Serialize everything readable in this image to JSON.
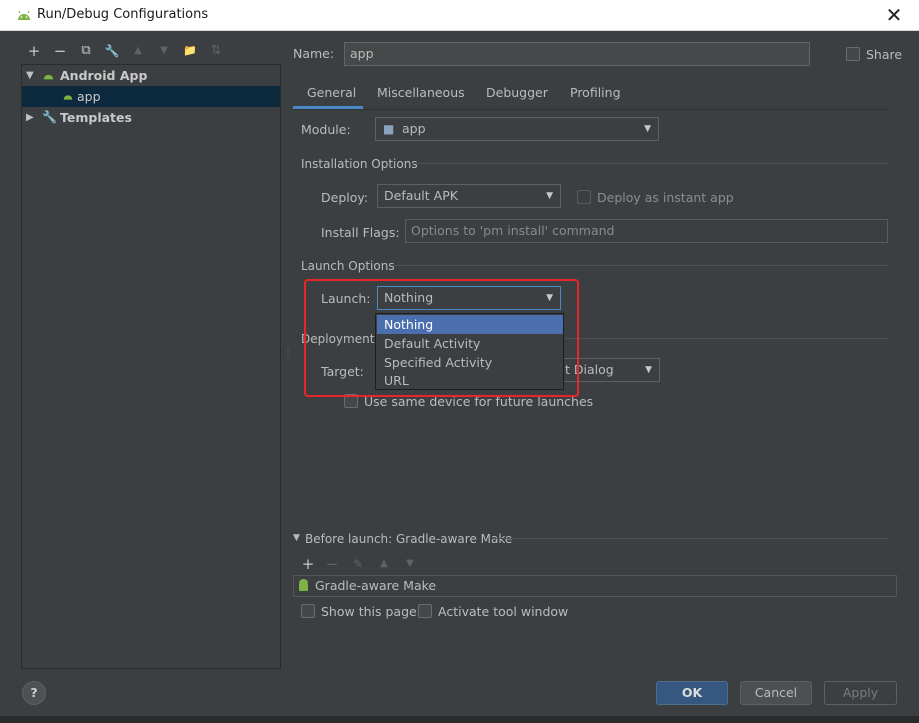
{
  "window": {
    "title": "Run/Debug Configurations",
    "close_glyph": "✕"
  },
  "left_toolbar": {
    "buttons": [
      {
        "name": "add",
        "glyph": "+"
      },
      {
        "name": "remove",
        "glyph": "−"
      },
      {
        "name": "copy",
        "glyph": "⧉"
      },
      {
        "name": "edit-defaults",
        "glyph": "🔧"
      },
      {
        "name": "move-up",
        "glyph": "▲"
      },
      {
        "name": "move-down",
        "glyph": "▼"
      },
      {
        "name": "new-folder",
        "glyph": "📁"
      },
      {
        "name": "sort",
        "glyph": "⇅"
      }
    ]
  },
  "tree": {
    "android_app": "Android App",
    "app": "app",
    "templates": "Templates"
  },
  "form": {
    "name_label": "Name:",
    "name_value": "app",
    "share_label": "Share",
    "tabs": [
      "General",
      "Miscellaneous",
      "Debugger",
      "Profiling"
    ],
    "active_tab": "General",
    "module_label": "Module:",
    "module_value": "app",
    "installation_title": "Installation Options",
    "deploy_label": "Deploy:",
    "deploy_value": "Default APK",
    "instant_label": "Deploy as instant app",
    "install_flags_label": "Install Flags:",
    "install_flags_placeholder": "Options to 'pm install' command",
    "launch_title": "Launch Options",
    "launch_label": "Launch:",
    "launch_value": "Nothing",
    "launch_options": [
      "Nothing",
      "Default Activity",
      "Specified Activity",
      "URL"
    ],
    "deployment_title": "Deployment T",
    "target_label": "Target:",
    "target_value": "t Dialog",
    "same_device_label": "Use same device for future launches"
  },
  "before_launch": {
    "title": "Before launch: Gradle-aware Make",
    "item": "Gradle-aware Make",
    "show_page": "Show this page",
    "activate_tool": "Activate tool window"
  },
  "buttons": {
    "help": "?",
    "ok": "OK",
    "cancel": "Cancel",
    "apply": "Apply"
  },
  "colors": {
    "accent": "#4a88c7",
    "selection": "#4b6eaf",
    "highlight_box": "#e8262a",
    "android_green": "#7cb342"
  }
}
